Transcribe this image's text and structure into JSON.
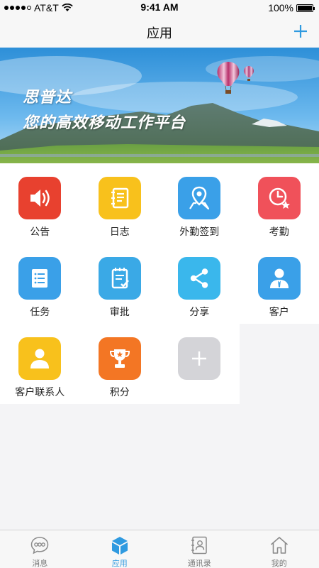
{
  "status_bar": {
    "carrier": "AT&T",
    "time": "9:41 AM",
    "battery": "100%"
  },
  "nav": {
    "title": "应用"
  },
  "banner": {
    "line1": "思普达",
    "line2": "您的高效移动工作平台"
  },
  "apps": [
    {
      "label": "公告",
      "icon": "speaker-icon",
      "color": "#e8412f"
    },
    {
      "label": "日志",
      "icon": "notebook-icon",
      "color": "#f8c11c"
    },
    {
      "label": "外勤签到",
      "icon": "location-pin-icon",
      "color": "#3aa0e8"
    },
    {
      "label": "考勤",
      "icon": "clock-star-icon",
      "color": "#f0515a"
    },
    {
      "label": "任务",
      "icon": "task-list-icon",
      "color": "#3aa0e8"
    },
    {
      "label": "审批",
      "icon": "approval-icon",
      "color": "#3aa9e6"
    },
    {
      "label": "分享",
      "icon": "share-icon",
      "color": "#3ab7ec"
    },
    {
      "label": "客户",
      "icon": "customer-icon",
      "color": "#3aa0e8"
    },
    {
      "label": "客户联系人",
      "icon": "contact-person-icon",
      "color": "#f8c11c"
    },
    {
      "label": "积分",
      "icon": "trophy-icon",
      "color": "#f37624"
    },
    {
      "label": "",
      "icon": "plus-icon",
      "color": "#d4d4d8"
    }
  ],
  "tabs": [
    {
      "label": "消息",
      "icon": "message-icon",
      "active": false
    },
    {
      "label": "应用",
      "icon": "apps-cube-icon",
      "active": true
    },
    {
      "label": "通讯录",
      "icon": "contacts-book-icon",
      "active": false
    },
    {
      "label": "我的",
      "icon": "home-icon",
      "active": false
    }
  ],
  "colors": {
    "accent": "#2f9ae0",
    "background": "#f4f4f6",
    "tile_bg": "#ffffff"
  }
}
